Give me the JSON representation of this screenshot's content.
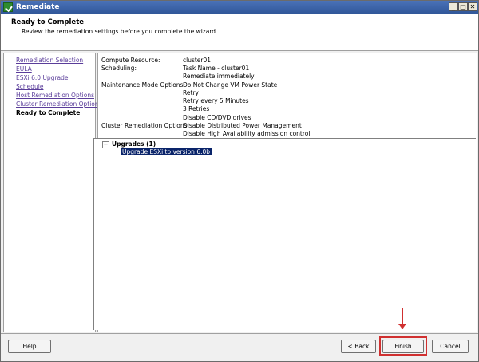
{
  "window": {
    "title": "Remediate",
    "controls": {
      "minimize": "_",
      "restore": "□",
      "close": "✕"
    }
  },
  "header": {
    "title": "Ready to Complete",
    "subtitle": "Review the remediation settings before you complete the wizard."
  },
  "nav": {
    "items": [
      {
        "label": "Remediation Selection",
        "current": false
      },
      {
        "label": "EULA",
        "current": false
      },
      {
        "label": "ESXi 6.0 Upgrade",
        "current": false
      },
      {
        "label": "Schedule",
        "current": false
      },
      {
        "label": "Host Remediation Options",
        "current": false
      },
      {
        "label": "Cluster Remediation Options",
        "current": false
      },
      {
        "label": "Ready to Complete",
        "current": true
      }
    ]
  },
  "summary": {
    "compute_label": "Compute Resource:",
    "compute_value": "cluster01",
    "scheduling_label": "Scheduling:",
    "scheduling_values": [
      "Task Name - cluster01",
      "Remediate immediately"
    ],
    "maintenance_label": "Maintenance Mode Options:",
    "maintenance_values": [
      "Do Not Change VM Power State",
      "Retry",
      "Retry every 5 Minutes",
      "3 Retries",
      "Disable CD/DVD drives"
    ],
    "cluster_label": "Cluster Remediation Options:",
    "cluster_values": [
      "Disable Distributed Power Management",
      "Disable High Availability admission control"
    ]
  },
  "tree": {
    "expander": "−",
    "node_label": "Upgrades (1)",
    "child_label": "Upgrade ESXi to version 6.0b"
  },
  "buttons": {
    "help": "Help",
    "back": "< Back",
    "finish": "Finish",
    "cancel": "Cancel"
  },
  "colors": {
    "link": "#5a3d9a",
    "highlight": "#d03030",
    "selection": "#0a246a"
  }
}
